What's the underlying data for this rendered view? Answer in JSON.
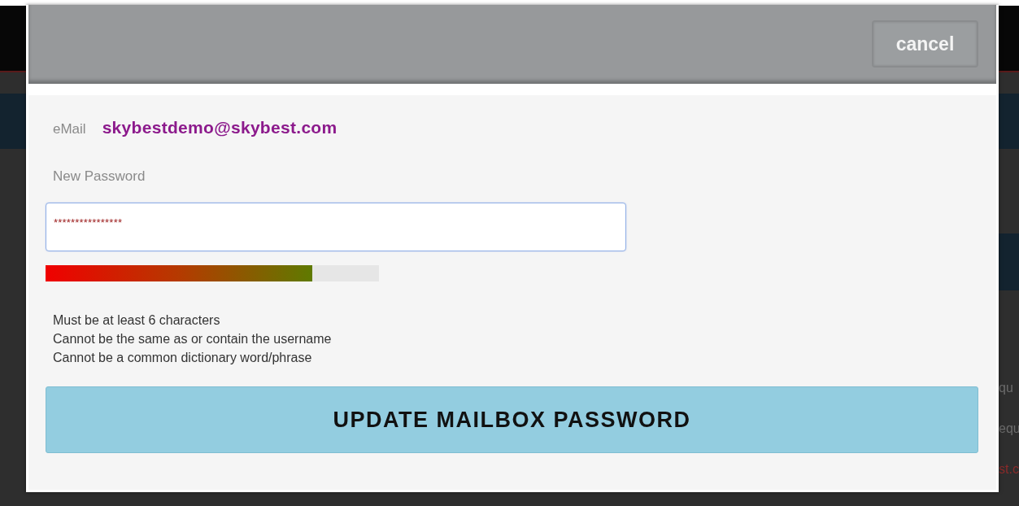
{
  "background": {
    "fragments": [
      {
        "text": "qu",
        "color": "#6b6b6b"
      },
      {
        "text": "equ",
        "color": "#6b6b6b"
      },
      {
        "text": "st.c",
        "color": "#8a2a2a"
      }
    ]
  },
  "dialog": {
    "cancel_button": "cancel",
    "email_label": "eMail",
    "email_value": "skybestdemo@skybest.com",
    "password_label": "New Password",
    "password_value": "****************",
    "strength": {
      "level": 0.8
    },
    "rules": [
      "Must be at least 6 characters",
      "Cannot be the same as or contain the username",
      "Cannot be a common dictionary word/phrase"
    ],
    "submit_button": "UPDATE MAILBOX PASSWORD"
  }
}
